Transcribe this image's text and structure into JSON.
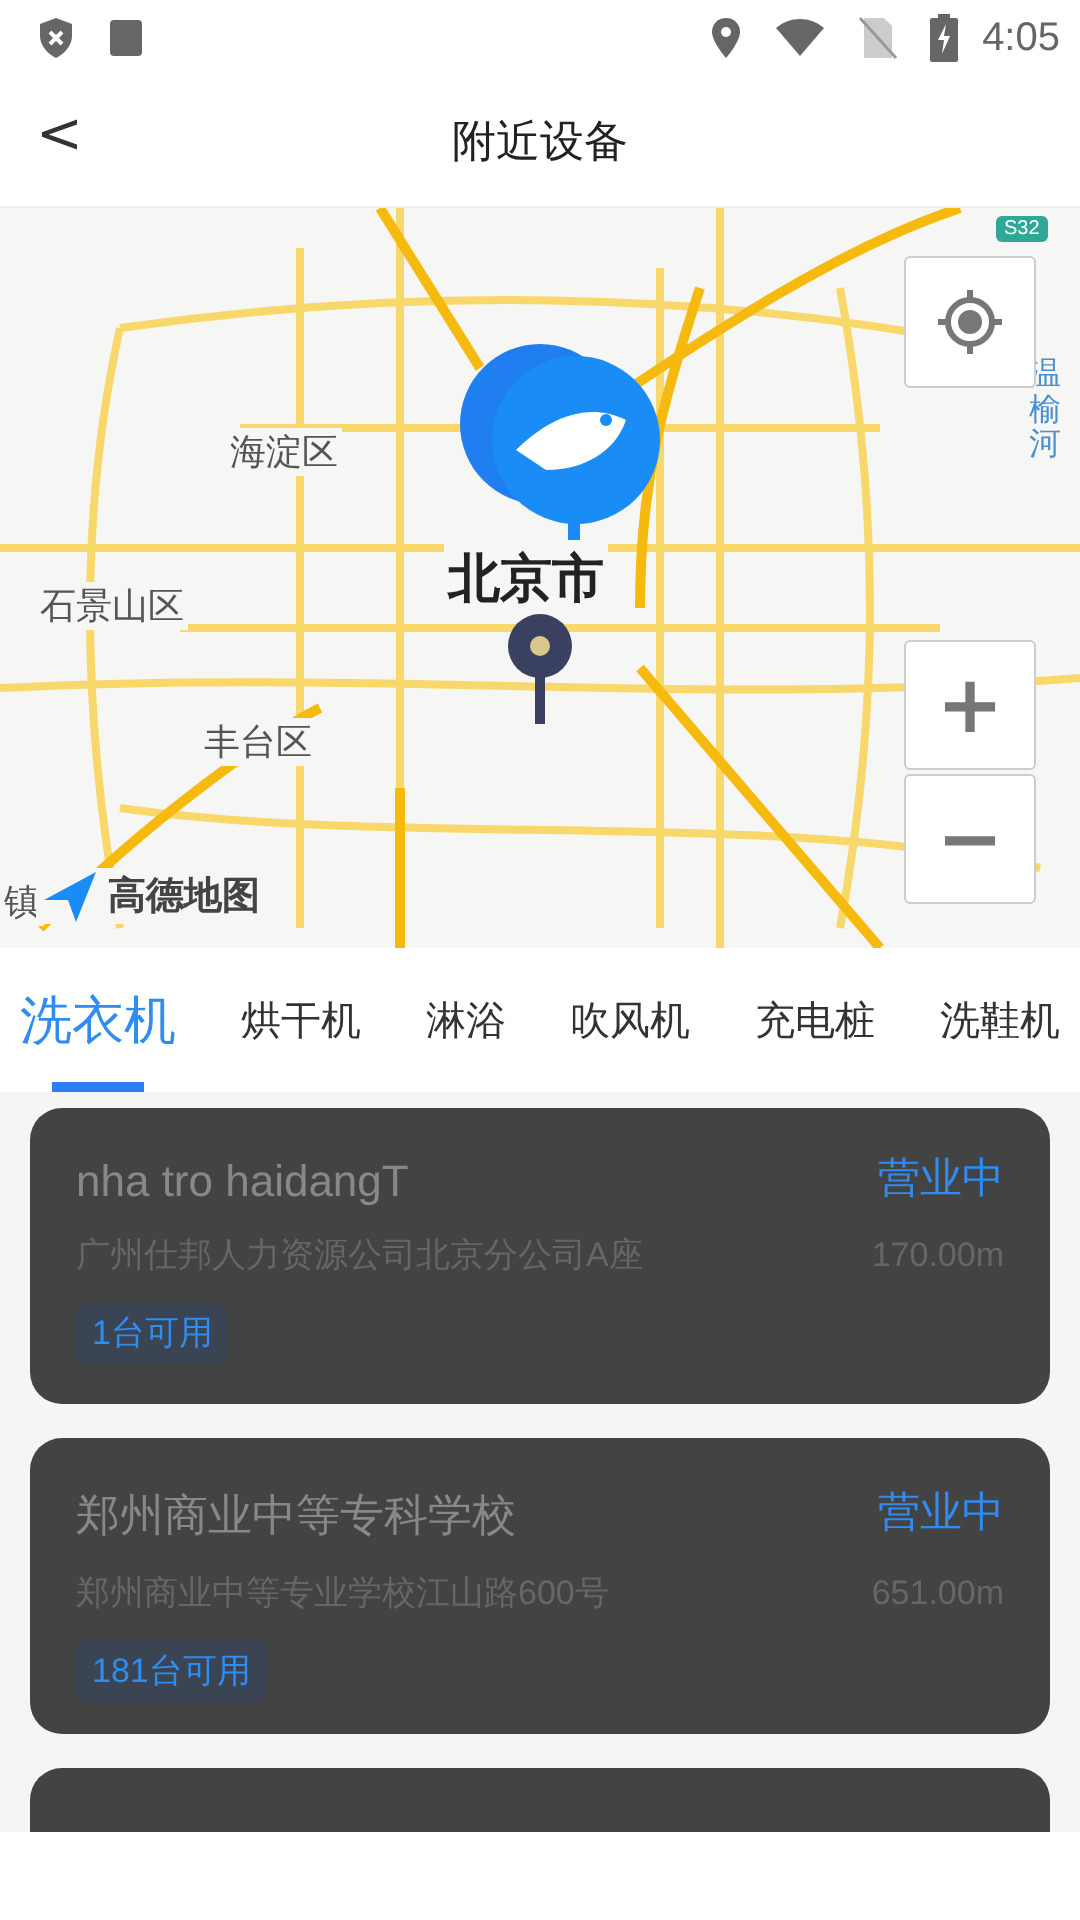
{
  "status_bar": {
    "time": "4:05"
  },
  "header": {
    "back": "<",
    "title": "附近设备"
  },
  "map": {
    "labels": [
      {
        "text": "海淀区",
        "kind": "district"
      },
      {
        "text": "石景山区",
        "kind": "district"
      },
      {
        "text": "丰台区",
        "kind": "district"
      },
      {
        "text": "北京市",
        "kind": "city"
      },
      {
        "text": "温榆河",
        "kind": "river"
      },
      {
        "text": "镇",
        "kind": "edge"
      }
    ],
    "logo": "高德地图",
    "road_sign": "S32",
    "zoom_in": "+",
    "zoom_out": "−"
  },
  "tabs": [
    {
      "label": "洗衣机",
      "selected": true
    },
    {
      "label": "烘干机",
      "selected": false
    },
    {
      "label": "淋浴",
      "selected": false
    },
    {
      "label": "吹风机",
      "selected": false
    },
    {
      "label": "充电桩",
      "selected": false
    },
    {
      "label": "洗鞋机",
      "selected": false
    }
  ],
  "stores": [
    {
      "name": "nha tro haidangT",
      "status": "营业中",
      "address": "广州仕邦人力资源公司北京分公司A座",
      "distance": "170.00m",
      "available": "1台可用"
    },
    {
      "name": "郑州商业中等专科学校",
      "status": "营业中",
      "address": "郑州商业中等专业学校江山路600号",
      "distance": "651.00m",
      "available": "181台可用"
    }
  ]
}
